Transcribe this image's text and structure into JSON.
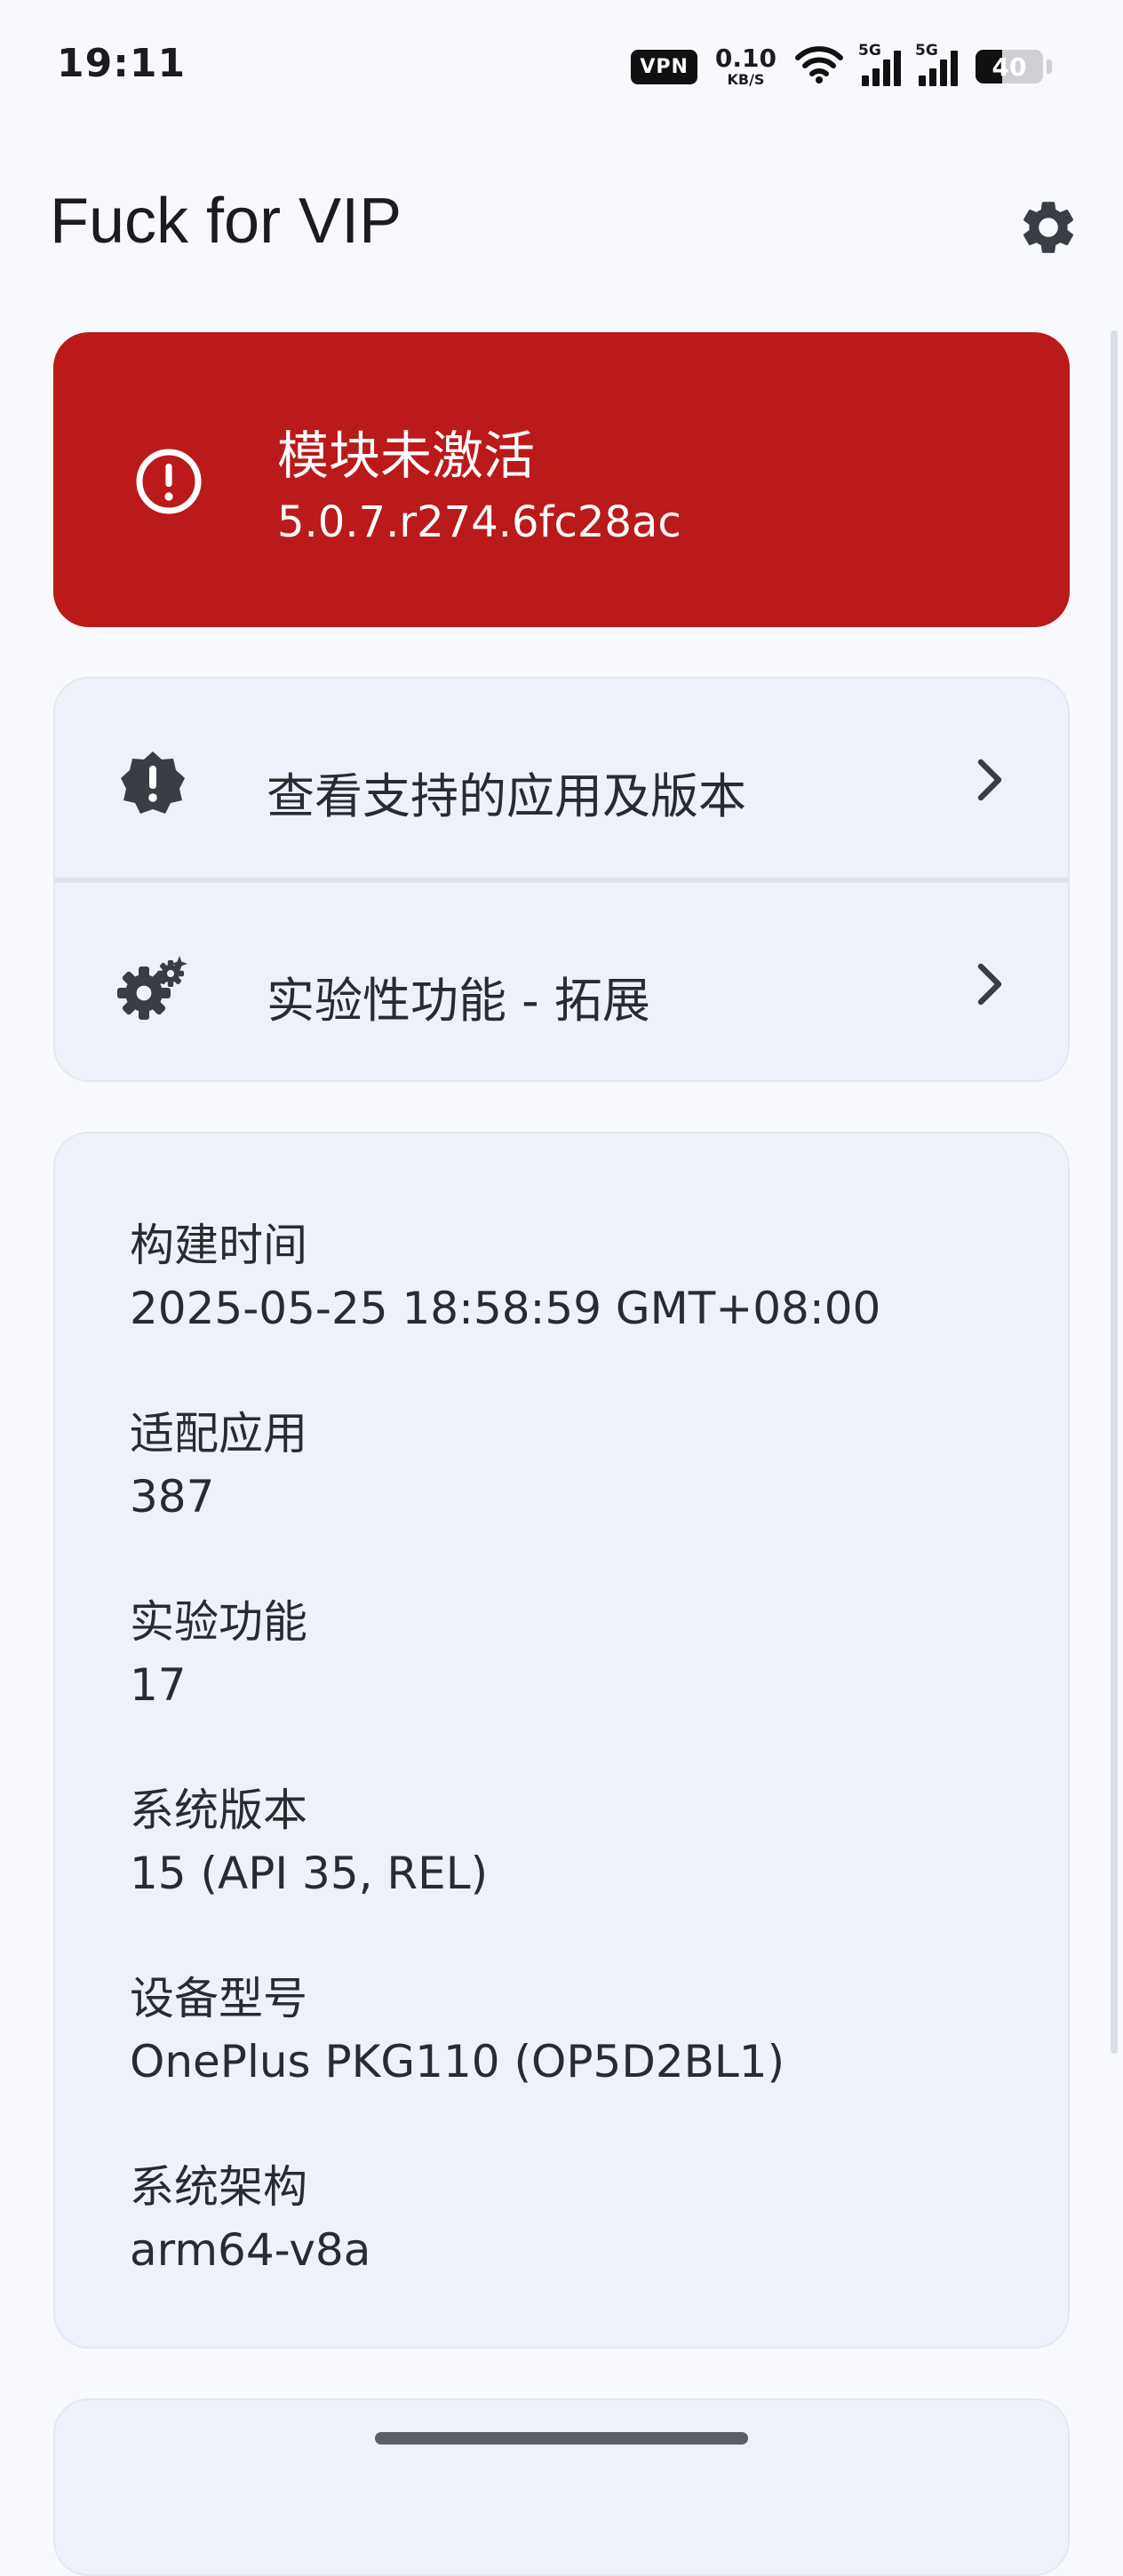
{
  "status_bar": {
    "time": "19:11",
    "vpn": "VPN",
    "speed_value": "0.10",
    "speed_unit": "KB/S",
    "network_1": "5G",
    "network_2": "5G",
    "battery": "40",
    "battery_level": 0.4
  },
  "app_bar": {
    "title": "Fuck for VIP"
  },
  "module_status": {
    "title": "模块未激活",
    "version": "5.0.7.r274.6fc28ac",
    "color": "#ba1a1a"
  },
  "menu": {
    "items": [
      {
        "label": "查看支持的应用及版本",
        "icon": "alert-badge-icon"
      },
      {
        "label": "实验性功能 - 拓展",
        "icon": "gears-sparkle-icon"
      }
    ]
  },
  "info": {
    "items": [
      {
        "label": "构建时间",
        "value": "2025-05-25 18:58:59 GMT+08:00"
      },
      {
        "label": "适配应用",
        "value": "387"
      },
      {
        "label": "实验功能",
        "value": "17"
      },
      {
        "label": "系统版本",
        "value": "15 (API 35, REL)"
      },
      {
        "label": "设备型号",
        "value": "OnePlus PKG110 (OP5D2BL1)"
      },
      {
        "label": "系统架构",
        "value": "arm64-v8a"
      }
    ]
  }
}
